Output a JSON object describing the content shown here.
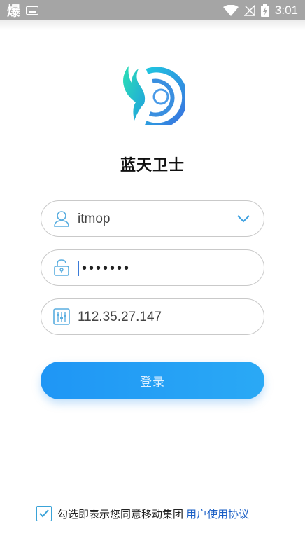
{
  "status_bar": {
    "app_glyph": "爆",
    "time": "3:01",
    "icons": [
      "keyboard-icon",
      "wifi-icon",
      "signal-off-icon",
      "battery-charging-icon"
    ]
  },
  "app": {
    "title": "蓝天卫士",
    "accent": "#2a9cf4"
  },
  "form": {
    "username": {
      "value": "itmop",
      "icon": "user-icon",
      "dropdown_icon": "chevron-down-icon"
    },
    "password": {
      "value": "•••••••",
      "icon": "lock-icon"
    },
    "server": {
      "value": "112.35.27.147",
      "icon": "server-settings-icon"
    },
    "login_label": "登录"
  },
  "agreement": {
    "checked": true,
    "text": "勾选即表示您同意移动集团",
    "link": "用户使用协议"
  }
}
